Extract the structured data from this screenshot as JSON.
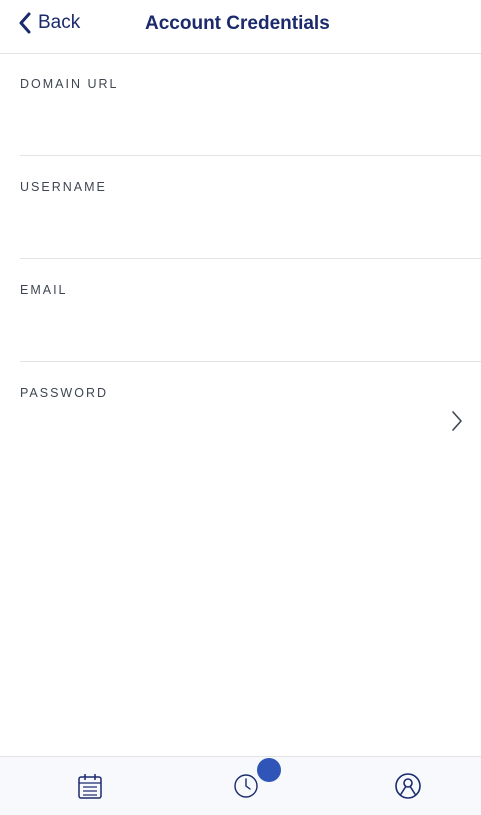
{
  "header": {
    "back_label": "Back",
    "title": "Account Credentials"
  },
  "form": {
    "fields": [
      {
        "label": "DOMAIN URL",
        "value": "",
        "placeholder": ""
      },
      {
        "label": "USERNAME",
        "value": "",
        "placeholder": ""
      },
      {
        "label": "EMAIL",
        "value": "",
        "placeholder": ""
      },
      {
        "label": "PASSWORD",
        "value": "",
        "placeholder": ""
      }
    ]
  },
  "tabbar": {
    "tabs": [
      {
        "icon": "calendar-icon"
      },
      {
        "icon": "clock-icon"
      },
      {
        "icon": "profile-icon"
      }
    ]
  },
  "colors": {
    "accent": "#1a2a6c",
    "badge": "#2f55b8",
    "divider": "#e3e3e3",
    "tabbar_bg": "#f8f9fc"
  }
}
